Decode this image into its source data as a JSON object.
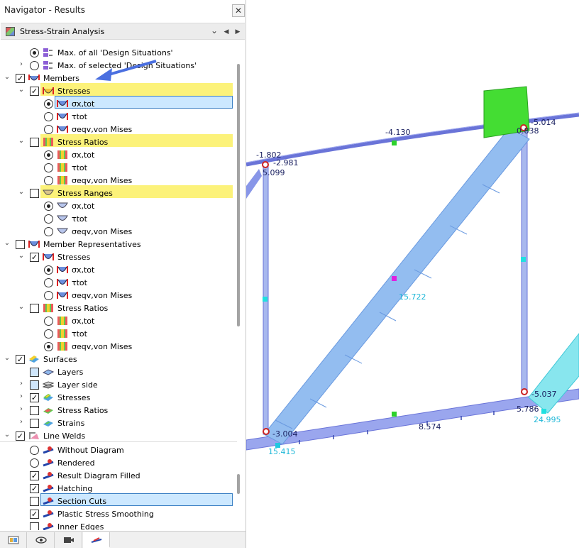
{
  "window": {
    "title": "Navigator - Results",
    "close": "✕"
  },
  "dropdown": {
    "value": "Stress-Strain Analysis",
    "chevron": "⌄",
    "prev": "◀",
    "next": "▶"
  },
  "tree": {
    "max_all": "Max. of all 'Design Situations'",
    "max_sel": "Max. of selected 'Design Situations'",
    "members": "Members",
    "stresses": "Stresses",
    "sigma_x_tot": "σx,tot",
    "tau_tot": "τtot",
    "sigma_eqv": "σeqv,von Mises",
    "stress_ratios": "Stress Ratios",
    "stress_ranges": "Stress Ranges",
    "member_reps": "Member Representatives",
    "surfaces": "Surfaces",
    "layers": "Layers",
    "layer_side": "Layer side",
    "strains": "Strains",
    "line_welds": "Line Welds",
    "without_diagram": "Without Diagram",
    "rendered": "Rendered",
    "result_filled": "Result Diagram Filled",
    "hatching": "Hatching",
    "section_cuts": "Section Cuts",
    "plastic_smoothing": "Plastic Stress Smoothing",
    "inner_edges": "Inner Edges"
  },
  "tabs": [
    "data-icon",
    "eye-icon",
    "camera-icon",
    "results-icon"
  ],
  "view_labels": {
    "v1": "-1.802",
    "v2": "-2.981",
    "v3": "5.099",
    "v4": "-4.130",
    "v5": "-5.014",
    "v6": "0.838",
    "v7": "15.722",
    "v8": "-5.037",
    "v9": "5.786",
    "v10": "24.995",
    "v11": "-3.004",
    "v12": "8.574",
    "v13": "15.415"
  },
  "colors": {
    "highlight_yellow": "#fcf27a",
    "selection_blue": "#cce8ff",
    "member_fill": "#8fb8ec",
    "accent_cyan": "#00c8e0",
    "support_green": "#3cd232"
  }
}
